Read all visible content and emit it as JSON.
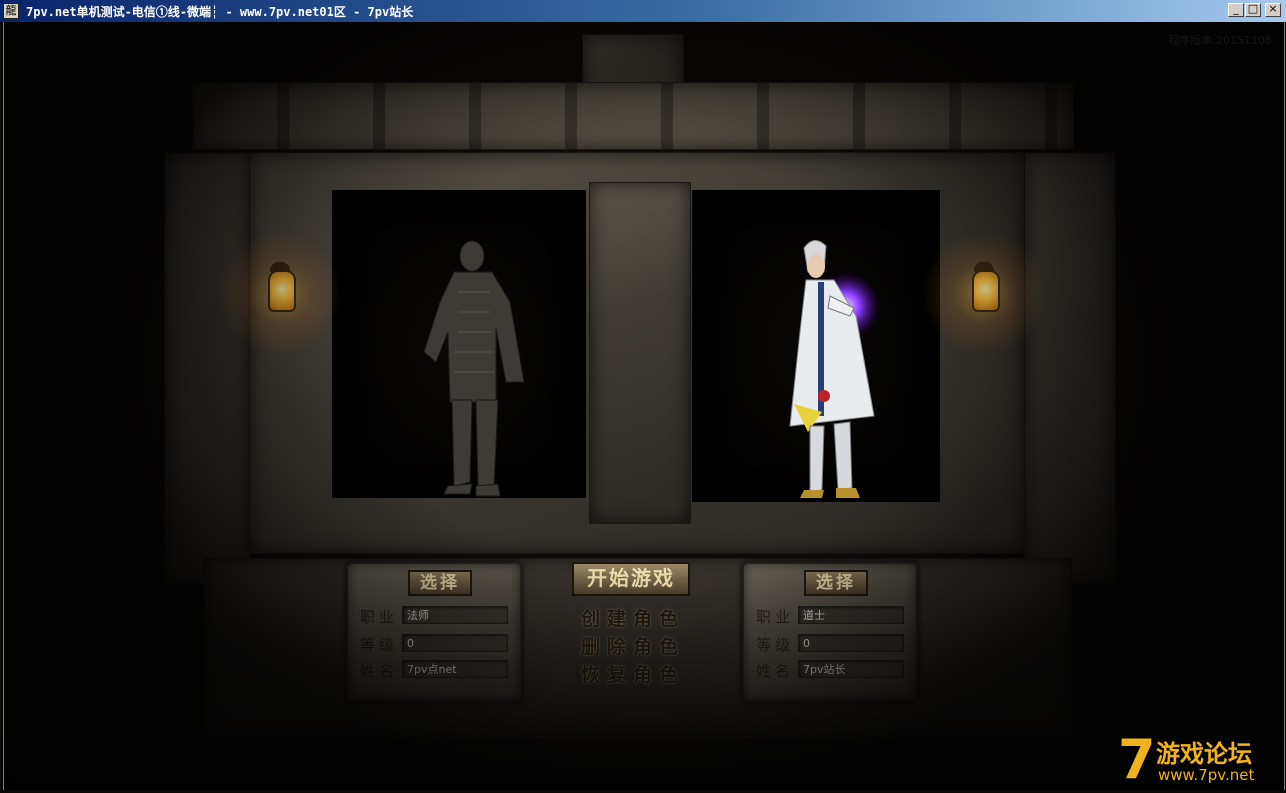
{
  "window": {
    "title": "7pv.net单机测试-电信①线-微端┆ - www.7pv.net01区 - 7pv站长",
    "icon_glyph": "龍",
    "controls": {
      "minimize": "_",
      "maximize": "□",
      "close": "×"
    }
  },
  "version_label": "程序版本:20151108",
  "left_slot": {
    "select_label": "选择",
    "fields": [
      {
        "label": "职业",
        "value": "法师"
      },
      {
        "label": "等级",
        "value": "0"
      },
      {
        "label": "姓名",
        "value": "7pv点net"
      }
    ]
  },
  "right_slot": {
    "select_label": "选择",
    "fields": [
      {
        "label": "职业",
        "value": "道士"
      },
      {
        "label": "等级",
        "value": "0"
      },
      {
        "label": "姓名",
        "value": "7pv站长"
      }
    ]
  },
  "center_menu": {
    "start_label": "开始游戏",
    "create_label": "创建角色",
    "delete_label": "删除角色",
    "restore_label": "恢复角色"
  },
  "watermark": {
    "seven": "7",
    "title": "游戏论坛",
    "url": "www.7pv.net"
  },
  "colors": {
    "accent_gold": "#f2b21c",
    "stone": "#4a453d",
    "title_bar": "#0a246a"
  }
}
